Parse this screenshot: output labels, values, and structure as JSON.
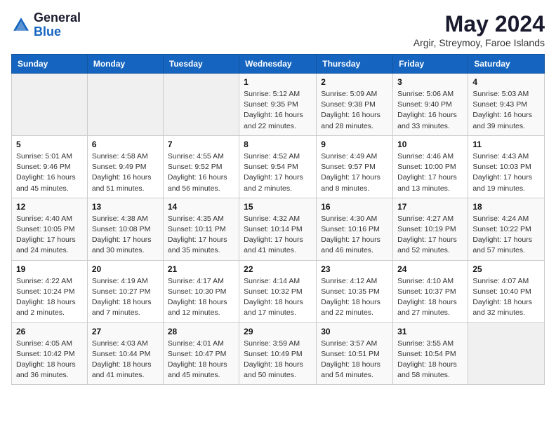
{
  "logo": {
    "general": "General",
    "blue": "Blue"
  },
  "title": "May 2024",
  "subtitle": "Argir, Streymoy, Faroe Islands",
  "headers": [
    "Sunday",
    "Monday",
    "Tuesday",
    "Wednesday",
    "Thursday",
    "Friday",
    "Saturday"
  ],
  "weeks": [
    [
      {
        "day": "",
        "info": ""
      },
      {
        "day": "",
        "info": ""
      },
      {
        "day": "",
        "info": ""
      },
      {
        "day": "1",
        "info": "Sunrise: 5:12 AM\nSunset: 9:35 PM\nDaylight: 16 hours and 22 minutes."
      },
      {
        "day": "2",
        "info": "Sunrise: 5:09 AM\nSunset: 9:38 PM\nDaylight: 16 hours and 28 minutes."
      },
      {
        "day": "3",
        "info": "Sunrise: 5:06 AM\nSunset: 9:40 PM\nDaylight: 16 hours and 33 minutes."
      },
      {
        "day": "4",
        "info": "Sunrise: 5:03 AM\nSunset: 9:43 PM\nDaylight: 16 hours and 39 minutes."
      }
    ],
    [
      {
        "day": "5",
        "info": "Sunrise: 5:01 AM\nSunset: 9:46 PM\nDaylight: 16 hours and 45 minutes."
      },
      {
        "day": "6",
        "info": "Sunrise: 4:58 AM\nSunset: 9:49 PM\nDaylight: 16 hours and 51 minutes."
      },
      {
        "day": "7",
        "info": "Sunrise: 4:55 AM\nSunset: 9:52 PM\nDaylight: 16 hours and 56 minutes."
      },
      {
        "day": "8",
        "info": "Sunrise: 4:52 AM\nSunset: 9:54 PM\nDaylight: 17 hours and 2 minutes."
      },
      {
        "day": "9",
        "info": "Sunrise: 4:49 AM\nSunset: 9:57 PM\nDaylight: 17 hours and 8 minutes."
      },
      {
        "day": "10",
        "info": "Sunrise: 4:46 AM\nSunset: 10:00 PM\nDaylight: 17 hours and 13 minutes."
      },
      {
        "day": "11",
        "info": "Sunrise: 4:43 AM\nSunset: 10:03 PM\nDaylight: 17 hours and 19 minutes."
      }
    ],
    [
      {
        "day": "12",
        "info": "Sunrise: 4:40 AM\nSunset: 10:05 PM\nDaylight: 17 hours and 24 minutes."
      },
      {
        "day": "13",
        "info": "Sunrise: 4:38 AM\nSunset: 10:08 PM\nDaylight: 17 hours and 30 minutes."
      },
      {
        "day": "14",
        "info": "Sunrise: 4:35 AM\nSunset: 10:11 PM\nDaylight: 17 hours and 35 minutes."
      },
      {
        "day": "15",
        "info": "Sunrise: 4:32 AM\nSunset: 10:14 PM\nDaylight: 17 hours and 41 minutes."
      },
      {
        "day": "16",
        "info": "Sunrise: 4:30 AM\nSunset: 10:16 PM\nDaylight: 17 hours and 46 minutes."
      },
      {
        "day": "17",
        "info": "Sunrise: 4:27 AM\nSunset: 10:19 PM\nDaylight: 17 hours and 52 minutes."
      },
      {
        "day": "18",
        "info": "Sunrise: 4:24 AM\nSunset: 10:22 PM\nDaylight: 17 hours and 57 minutes."
      }
    ],
    [
      {
        "day": "19",
        "info": "Sunrise: 4:22 AM\nSunset: 10:24 PM\nDaylight: 18 hours and 2 minutes."
      },
      {
        "day": "20",
        "info": "Sunrise: 4:19 AM\nSunset: 10:27 PM\nDaylight: 18 hours and 7 minutes."
      },
      {
        "day": "21",
        "info": "Sunrise: 4:17 AM\nSunset: 10:30 PM\nDaylight: 18 hours and 12 minutes."
      },
      {
        "day": "22",
        "info": "Sunrise: 4:14 AM\nSunset: 10:32 PM\nDaylight: 18 hours and 17 minutes."
      },
      {
        "day": "23",
        "info": "Sunrise: 4:12 AM\nSunset: 10:35 PM\nDaylight: 18 hours and 22 minutes."
      },
      {
        "day": "24",
        "info": "Sunrise: 4:10 AM\nSunset: 10:37 PM\nDaylight: 18 hours and 27 minutes."
      },
      {
        "day": "25",
        "info": "Sunrise: 4:07 AM\nSunset: 10:40 PM\nDaylight: 18 hours and 32 minutes."
      }
    ],
    [
      {
        "day": "26",
        "info": "Sunrise: 4:05 AM\nSunset: 10:42 PM\nDaylight: 18 hours and 36 minutes."
      },
      {
        "day": "27",
        "info": "Sunrise: 4:03 AM\nSunset: 10:44 PM\nDaylight: 18 hours and 41 minutes."
      },
      {
        "day": "28",
        "info": "Sunrise: 4:01 AM\nSunset: 10:47 PM\nDaylight: 18 hours and 45 minutes."
      },
      {
        "day": "29",
        "info": "Sunrise: 3:59 AM\nSunset: 10:49 PM\nDaylight: 18 hours and 50 minutes."
      },
      {
        "day": "30",
        "info": "Sunrise: 3:57 AM\nSunset: 10:51 PM\nDaylight: 18 hours and 54 minutes."
      },
      {
        "day": "31",
        "info": "Sunrise: 3:55 AM\nSunset: 10:54 PM\nDaylight: 18 hours and 58 minutes."
      },
      {
        "day": "",
        "info": ""
      }
    ]
  ]
}
